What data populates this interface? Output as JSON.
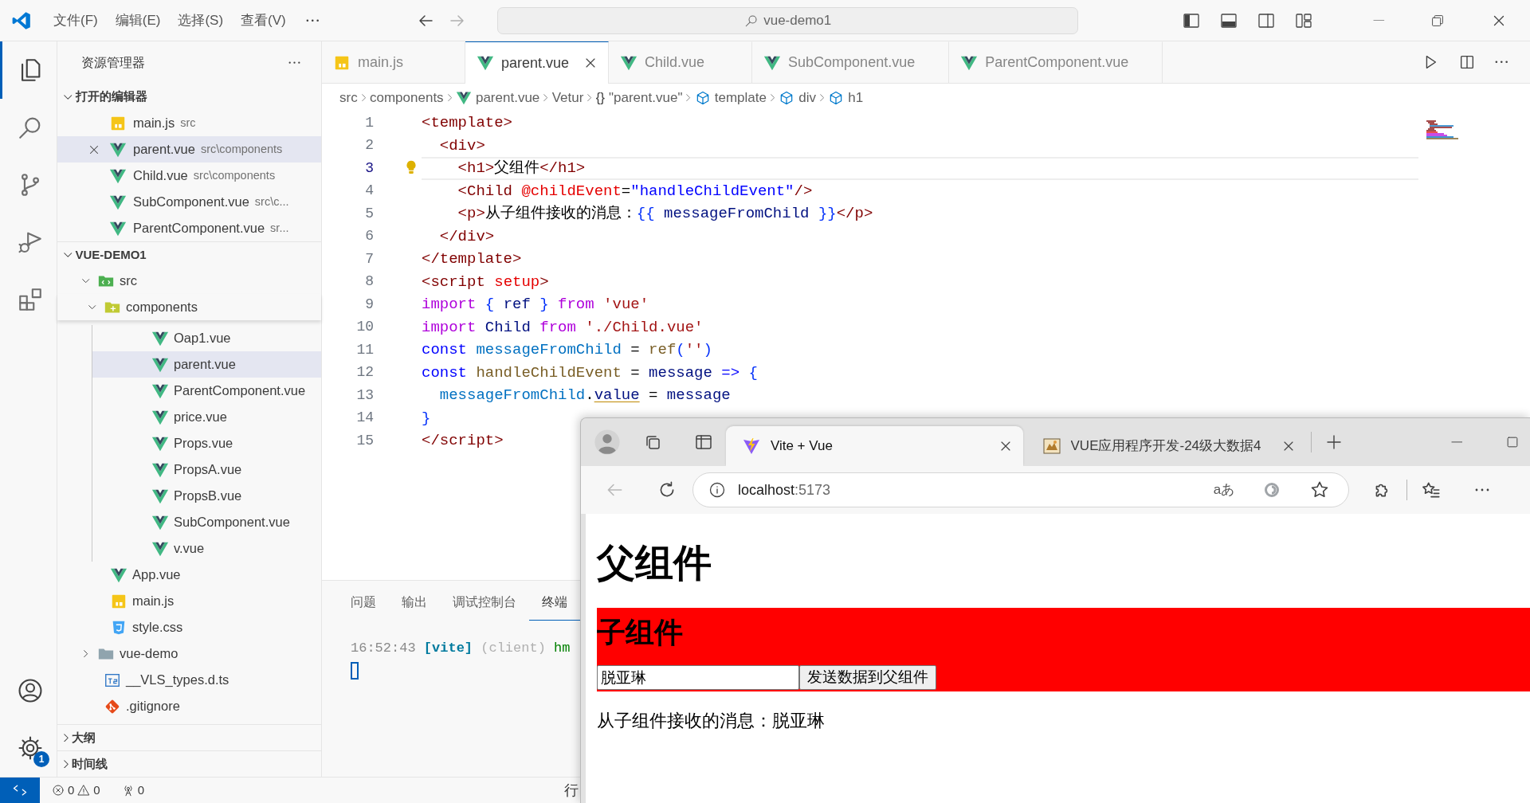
{
  "title_bar": {
    "menus": [
      "文件(F)",
      "编辑(E)",
      "选择(S)",
      "查看(V)"
    ],
    "search": "vue-demo1"
  },
  "activity_bar": {
    "items": [
      {
        "kind": "explorer",
        "selected": true
      },
      {
        "kind": "search",
        "selected": false
      },
      {
        "kind": "source-control",
        "selected": false
      },
      {
        "kind": "run-debug",
        "selected": false
      },
      {
        "kind": "extensions",
        "selected": false
      }
    ],
    "settings_badge": "1"
  },
  "explorer": {
    "title": "资源管理器",
    "open_editors": {
      "title": "打开的编辑器",
      "expanded": true,
      "items": [
        {
          "name": "main.js",
          "path": "src",
          "kind": "js",
          "selected": false
        },
        {
          "name": "parent.vue",
          "path": "src\\components",
          "kind": "vue",
          "selected": true
        },
        {
          "name": "Child.vue",
          "path": "src\\components",
          "kind": "vue",
          "selected": false
        },
        {
          "name": "SubComponent.vue",
          "path": "src\\c...",
          "kind": "vue",
          "selected": false
        },
        {
          "name": "ParentComponent.vue",
          "path": "sr...",
          "kind": "vue",
          "selected": false
        }
      ]
    },
    "project": {
      "title": "VUE-DEMO1",
      "expanded": true,
      "tree": [
        {
          "name": "src",
          "kind": "src-folder",
          "expanded": true,
          "selected": false,
          "children": [
            {
              "name": "components",
              "kind": "components-folder",
              "expanded": true,
              "selected": false,
              "children": [
                {
                  "name": "Oap1.vue",
                  "kind": "vue",
                  "selected": false
                },
                {
                  "name": "parent.vue",
                  "kind": "vue",
                  "selected": true
                },
                {
                  "name": "ParentComponent.vue",
                  "kind": "vue",
                  "selected": false
                },
                {
                  "name": "price.vue",
                  "kind": "vue",
                  "selected": false
                },
                {
                  "name": "Props.vue",
                  "kind": "vue",
                  "selected": false
                },
                {
                  "name": "PropsA.vue",
                  "kind": "vue",
                  "selected": false
                },
                {
                  "name": "PropsB.vue",
                  "kind": "vue",
                  "selected": false
                },
                {
                  "name": "SubComponent.vue",
                  "kind": "vue",
                  "selected": false
                },
                {
                  "name": "v.vue",
                  "kind": "vue",
                  "selected": false
                }
              ]
            },
            {
              "name": "App.vue",
              "kind": "vue",
              "selected": false
            },
            {
              "name": "main.js",
              "kind": "js",
              "selected": false
            },
            {
              "name": "style.css",
              "kind": "css",
              "selected": false
            }
          ]
        },
        {
          "name": "vue-demo",
          "kind": "folder",
          "expanded": false,
          "selected": false
        },
        {
          "name": "__VLS_types.d.ts",
          "kind": "ts",
          "selected": false
        },
        {
          "name": ".gitignore",
          "kind": "git",
          "selected": false
        }
      ]
    },
    "outline": {
      "title": "大纲",
      "expanded": false
    },
    "timeline": {
      "title": "时间线",
      "expanded": false
    }
  },
  "editor": {
    "tabs": [
      {
        "name": "main.js",
        "kind": "js",
        "selected": false
      },
      {
        "name": "parent.vue",
        "kind": "vue",
        "selected": true
      },
      {
        "name": "Child.vue",
        "kind": "vue",
        "selected": false
      },
      {
        "name": "SubComponent.vue",
        "kind": "vue",
        "selected": false
      },
      {
        "name": "ParentComponent.vue",
        "kind": "vue",
        "selected": false
      }
    ],
    "breadcrumbs": [
      {
        "text": "src",
        "kind": "plain"
      },
      {
        "text": "components",
        "kind": "plain"
      },
      {
        "text": "parent.vue",
        "kind": "vue"
      },
      {
        "text": "Vetur",
        "kind": "plain"
      },
      {
        "text": "\"parent.vue\"",
        "kind": "symbol",
        "symbol": "{}"
      },
      {
        "text": "template",
        "kind": "element"
      },
      {
        "text": "div",
        "kind": "element"
      },
      {
        "text": "h1",
        "kind": "element"
      }
    ],
    "lines": [
      {
        "number": "1",
        "current": false,
        "tokens": [
          {
            "text": "<template>",
            "kind": "tag"
          }
        ]
      },
      {
        "number": "2",
        "current": false,
        "tokens": [
          {
            "text": "  <div>",
            "kind": "tag"
          }
        ]
      },
      {
        "number": "3",
        "current": true,
        "tokens": [
          {
            "text": "    <h1>",
            "kind": "tag"
          },
          {
            "text": "父组件",
            "kind": "text"
          },
          {
            "text": "</h1>",
            "kind": "tag"
          }
        ]
      },
      {
        "number": "4",
        "current": false,
        "tokens": [
          {
            "text": "    <Child",
            "kind": "tag"
          },
          {
            "text": " @childEvent",
            "kind": "attr"
          },
          {
            "text": "=",
            "kind": "plain"
          },
          {
            "text": "\"handleChildEvent\"",
            "kind": "value"
          },
          {
            "text": "/>",
            "kind": "tag"
          }
        ]
      },
      {
        "number": "5",
        "current": false,
        "tokens": [
          {
            "text": "    <p>",
            "kind": "tag"
          },
          {
            "text": "从子组件接收的消息：",
            "kind": "text"
          },
          {
            "text": "{{",
            "kind": "brace"
          },
          {
            "text": " messageFromChild ",
            "kind": "variable"
          },
          {
            "text": "}}",
            "kind": "brace"
          },
          {
            "text": "</p>",
            "kind": "tag"
          }
        ]
      },
      {
        "number": "6",
        "current": false,
        "tokens": [
          {
            "text": "  </div>",
            "kind": "tag"
          }
        ]
      },
      {
        "number": "7",
        "current": false,
        "tokens": [
          {
            "text": "</template>",
            "kind": "tag"
          }
        ]
      },
      {
        "number": "8",
        "current": false,
        "tokens": [
          {
            "text": "<script",
            "kind": "tag"
          },
          {
            "text": " setup",
            "kind": "attr"
          },
          {
            "text": ">",
            "kind": "tag"
          }
        ]
      },
      {
        "number": "9",
        "current": false,
        "tokens": [
          {
            "text": "import",
            "kind": "keyword"
          },
          {
            "text": " {",
            "kind": "brace"
          },
          {
            "text": " ref",
            "kind": "variable"
          },
          {
            "text": " }",
            "kind": "brace"
          },
          {
            "text": " from",
            "kind": "keyword"
          },
          {
            "text": " 'vue'",
            "kind": "string"
          }
        ]
      },
      {
        "number": "10",
        "current": false,
        "tokens": [
          {
            "text": "import",
            "kind": "keyword"
          },
          {
            "text": " Child",
            "kind": "variable"
          },
          {
            "text": " from",
            "kind": "keyword"
          },
          {
            "text": " './Child.vue'",
            "kind": "string"
          }
        ]
      },
      {
        "number": "11",
        "current": false,
        "tokens": [
          {
            "text": "const",
            "kind": "storage"
          },
          {
            "text": " messageFromChild",
            "kind": "constant"
          },
          {
            "text": " =",
            "kind": "plain"
          },
          {
            "text": " ref",
            "kind": "function"
          },
          {
            "text": "(",
            "kind": "brace"
          },
          {
            "text": "''",
            "kind": "string"
          },
          {
            "text": ")",
            "kind": "brace"
          }
        ]
      },
      {
        "number": "12",
        "current": false,
        "tokens": [
          {
            "text": "const",
            "kind": "storage"
          },
          {
            "text": " handleChildEvent",
            "kind": "function"
          },
          {
            "text": " =",
            "kind": "plain"
          },
          {
            "text": " message",
            "kind": "variable"
          },
          {
            "text": " =>",
            "kind": "storage"
          },
          {
            "text": " {",
            "kind": "brace"
          }
        ]
      },
      {
        "number": "13",
        "current": false,
        "tokens": [
          {
            "text": "  messageFromChild",
            "kind": "constant"
          },
          {
            "text": ".",
            "kind": "plain"
          },
          {
            "text": "value",
            "kind": "warned"
          },
          {
            "text": " =",
            "kind": "plain"
          },
          {
            "text": " message",
            "kind": "variable"
          }
        ]
      },
      {
        "number": "14",
        "current": false,
        "tokens": [
          {
            "text": "}",
            "kind": "brace"
          }
        ]
      },
      {
        "number": "15",
        "current": false,
        "tokens": [
          {
            "text": "</script>",
            "kind": "tag"
          }
        ]
      }
    ]
  },
  "panel": {
    "tabs": [
      {
        "label": "问题",
        "selected": false
      },
      {
        "label": "输出",
        "selected": false
      },
      {
        "label": "调试控制台",
        "selected": false
      },
      {
        "label": "终端",
        "selected": true
      }
    ],
    "terminal": [
      {
        "text": "16:52:43",
        "kind": "time"
      },
      {
        "text": " [vite]",
        "kind": "source"
      },
      {
        "text": " (client)",
        "kind": "dim"
      },
      {
        "text": " hm",
        "kind": "ok"
      }
    ]
  },
  "status_bar": {
    "errors": "0",
    "warnings": "0",
    "ports": "0",
    "position": "行"
  },
  "browser": {
    "tabs": [
      {
        "title": "Vite + Vue",
        "kind": "vite",
        "selected": true
      },
      {
        "title": "VUE应用程序开发-24级大数据4",
        "kind": "site",
        "selected": false
      }
    ],
    "back": {
      "disabled": true
    },
    "address": {
      "host": "localhost",
      "port": ":5173"
    },
    "read_aloud": "aあ",
    "page": {
      "heading": "父组件",
      "child": {
        "heading": "子组件",
        "input_value": "脱亚琳",
        "button": "发送数据到父组件"
      },
      "message": "从子组件接收的消息：脱亚琳"
    }
  }
}
